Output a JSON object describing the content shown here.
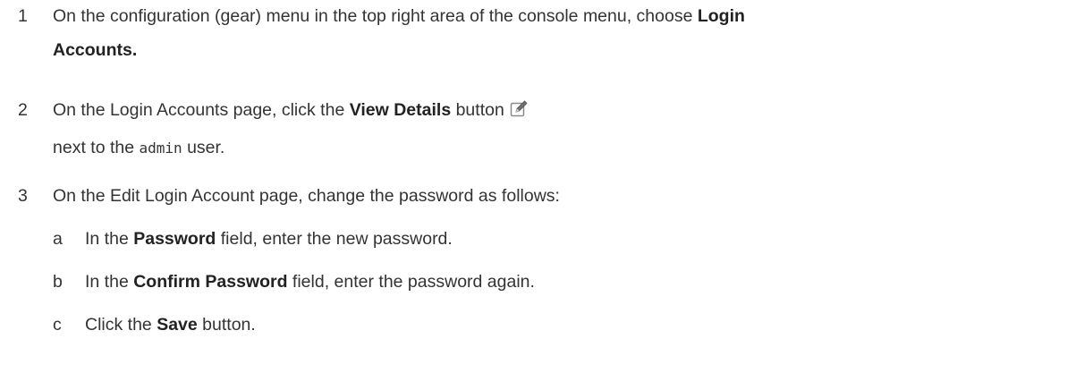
{
  "steps": [
    {
      "number": "1",
      "line1_text": "On the configuration (gear) menu in the top right area of the console menu, choose ",
      "line1_bold": "Login",
      "line2_bold": "Accounts."
    },
    {
      "number": "2",
      "text_before": "On the Login Accounts page, click the ",
      "bold": "View Details",
      "text_after": " button",
      "line2_before": "next to the ",
      "line2_code": "admin",
      "line2_after": " user."
    },
    {
      "number": "3",
      "text": "On the Edit Login Account page, change the password as follows:",
      "substeps": [
        {
          "letter": "a",
          "before": "In the ",
          "bold": "Password",
          "after": " field, enter the new password."
        },
        {
          "letter": "b",
          "before": "In the ",
          "bold": "Confirm Password",
          "after": " field, enter the password again."
        },
        {
          "letter": "c",
          "before": "Click the ",
          "bold": "Save",
          "after": " button."
        }
      ]
    }
  ],
  "icons": {
    "view_details": "edit-icon"
  }
}
